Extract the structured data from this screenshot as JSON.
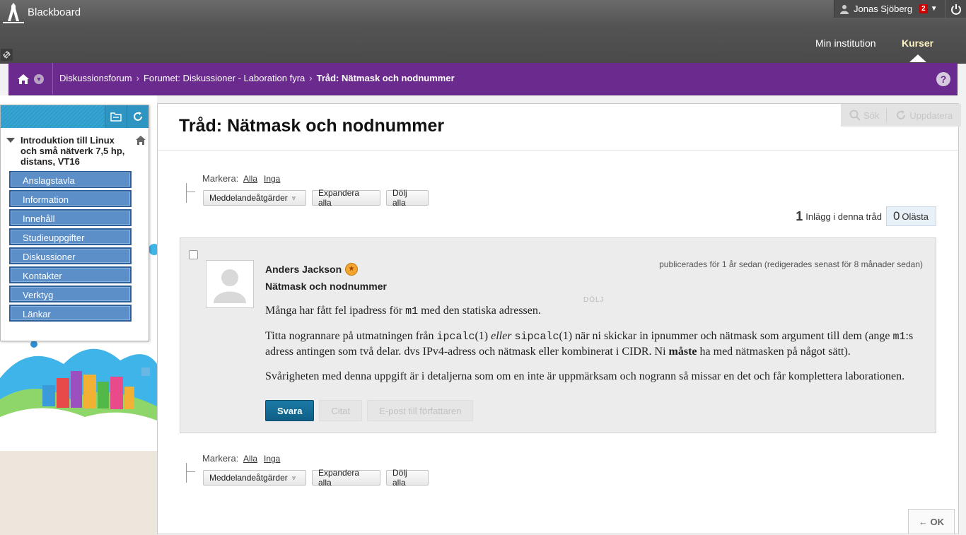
{
  "header": {
    "brand": "Blackboard",
    "user_name": "Jonas Sjöberg",
    "notification_count": "2",
    "tabs": [
      "Min institution",
      "Kurser"
    ]
  },
  "breadcrumb": {
    "items": [
      "Diskussionsforum",
      "Forumet: Diskussioner - Laboration fyra"
    ],
    "current": "Tråd: Nätmask och nodnummer"
  },
  "course_menu": {
    "title": "Introduktion till Linux och små nätverk 7,5 hp, distans, VT16",
    "items": [
      "Anslagstavla",
      "Information",
      "Innehåll",
      "Studieuppgifter",
      "Diskussioner",
      "Kontakter",
      "Verktyg",
      "Länkar"
    ]
  },
  "page": {
    "title": "Tråd: Nätmask och nodnummer",
    "tools": {
      "search": "Sök",
      "refresh": "Uppdatera"
    },
    "select": {
      "label": "Markera:",
      "all": "Alla",
      "none": "Inga",
      "actions": "Meddelandeåtgärder",
      "expand": "Expandera alla",
      "collapse": "Dölj alla"
    },
    "thread_count": {
      "posts": "1",
      "posts_label": "Inlägg i denna tråd",
      "unread": "0",
      "unread_label": "Olästa"
    },
    "ok": "← OK"
  },
  "post": {
    "author": "Anders Jackson",
    "meta": "publicerades för 1 år sedan (redigerades senast för 8 månader sedan)",
    "subject": "Nätmask och nodnummer",
    "hide": "DÖLJ",
    "body": {
      "p1_a": "Många har fått fel ipadress för ",
      "p1_code": "m1",
      "p1_b": " med den statiska adressen.",
      "p2_a": "Titta nogrannare på utmatningen från ",
      "p2_code1": "ipcalc",
      "p2_b": "(1) ",
      "p2_em": "eller",
      "p2_c": " ",
      "p2_code2": "sipcalc",
      "p2_d": "(1) när ni skickar in ipnummer och nätmask som argument till dem (ange ",
      "p2_code3": "m1",
      "p2_e": ":s adress antingen som två delar. dvs IPv4-adress och nätmask eller kombinerat i CIDR.  Ni ",
      "p2_strong": "måste",
      "p2_f": " ha med nätmasken på något sätt).",
      "p3": "Svårigheten med denna uppgift är i detaljerna som om en inte är uppmärksam och nogrann så missar en det och får komplettera laborationen."
    },
    "actions": {
      "reply": "Svara",
      "quote": "Citat",
      "email": "E-post till författaren"
    }
  }
}
